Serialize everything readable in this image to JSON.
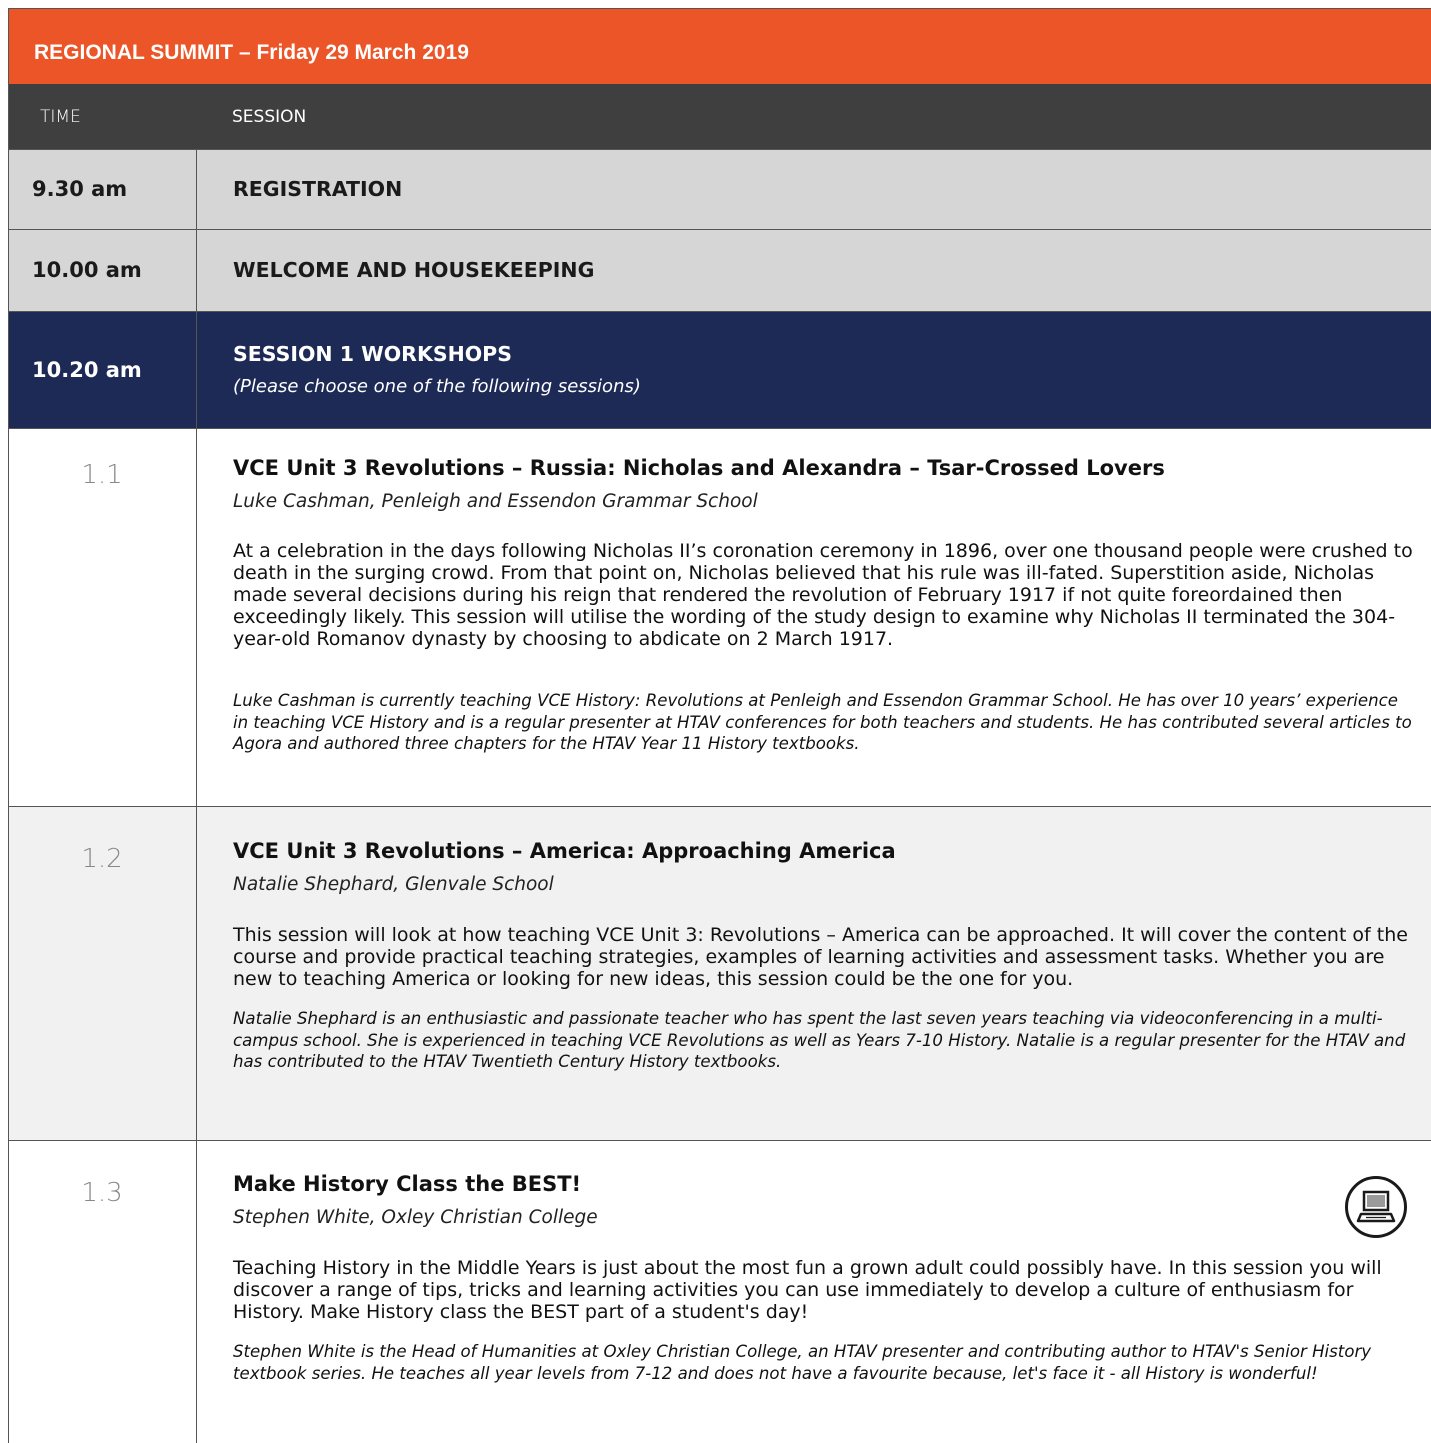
{
  "title": "REGIONAL SUMMIT – Friday 29 March 2019",
  "header": {
    "time": "TIME",
    "session": "SESSION"
  },
  "rows": [
    {
      "time": "9.30 am",
      "label": "REGISTRATION"
    },
    {
      "time": "10.00 am",
      "label": "WELCOME AND HOUSEKEEPING"
    },
    {
      "time": "10.20 am",
      "label": "SESSION 1 WORKSHOPS",
      "note": "(Please choose one of the following sessions)"
    }
  ],
  "sessions": [
    {
      "number": "1.1",
      "title": "VCE Unit 3 Revolutions – Russia: Nicholas and Alexandra – Tsar-Crossed Lovers",
      "presenter": "Luke Cashman, Penleigh and Essendon Grammar School",
      "description": "At a celebration in the days following Nicholas II’s coronation ceremony in 1896, over one thousand people were crushed to death in the surging crowd. From that point on, Nicholas believed that his rule was ill-fated. Superstition aside, Nicholas made several decisions during his reign that rendered the revolution of February 1917 if not quite foreordained then exceedingly likely. This session will utilise the wording of the study design to examine why Nicholas II terminated the 304-year-old Romanov dynasty by choosing to abdicate on 2 March 1917.",
      "bio": "Luke Cashman is currently teaching VCE History: Revolutions at Penleigh and Essendon Grammar School. He has over 10 years’ experience in teaching VCE History and is a regular presenter at HTAV conferences for both teachers and students. He has contributed several articles to Agora and authored three chapters for the HTAV Year 11 History textbooks."
    },
    {
      "number": "1.2",
      "title": "VCE Unit 3 Revolutions – America: Approaching America",
      "presenter": "Natalie Shephard, Glenvale School",
      "description": "This session will look at how teaching VCE Unit 3: Revolutions – America can be approached. It will cover the content of the course and provide practical teaching strategies, examples of learning activities and assessment tasks. Whether you are new to teaching America or looking for new ideas, this session could be the one for you.",
      "bio": "Natalie Shephard is an enthusiastic and passionate teacher who has spent the last seven years teaching via videoconferencing in a multi-campus school. She is experienced in teaching VCE Revolutions as well as Years 7-10 History. Natalie is a regular presenter for the HTAV and has contributed to the HTAV Twentieth Century History textbooks."
    },
    {
      "number": "1.3",
      "title": "Make History Class the BEST!",
      "presenter": "Stephen White, Oxley Christian College",
      "description": "Teaching History in the Middle Years is just about the most fun a grown adult could possibly have. In this session you will discover a range of tips, tricks and learning activities you can use immediately to develop a culture of enthusiasm for History. Make History class the BEST part of a student's day!",
      "bio": "Stephen White is the Head of Humanities at Oxley Christian College, an HTAV presenter and contributing author to HTAV's Senior History textbook series. He teaches all year levels from 7-12 and does not have a favourite because, let's face it - all History is wonderful!",
      "icon": "computer-icon"
    }
  ],
  "colors": {
    "title_bar": "#ec5527",
    "header_row": "#3f3f3f",
    "plain_row": "#d6d6d6",
    "workshop_row": "#1e2a56",
    "alt_session": "#f1f1f1"
  }
}
